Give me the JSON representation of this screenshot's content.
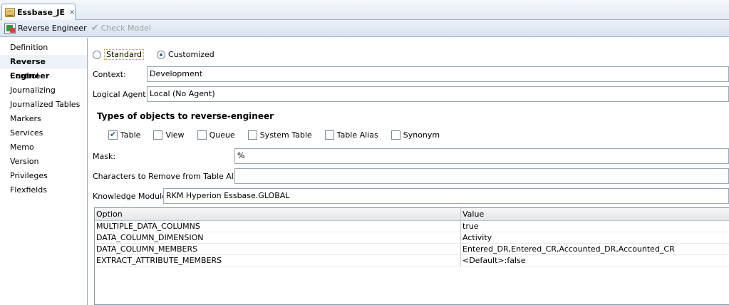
{
  "tab": {
    "title": "Essbase_JE",
    "close": "×"
  },
  "toolbar": {
    "reverse_engineer": "Reverse Engineer",
    "check_model": "Check Model"
  },
  "nav": {
    "items": [
      {
        "label": "Definition"
      },
      {
        "label": "Reverse Engineer",
        "selected": true
      },
      {
        "label": "Control"
      },
      {
        "label": "Journalizing"
      },
      {
        "label": "Journalized Tables"
      },
      {
        "label": "Markers"
      },
      {
        "label": "Services"
      },
      {
        "label": "Memo"
      },
      {
        "label": "Version"
      },
      {
        "label": "Privileges"
      },
      {
        "label": "Flexfields"
      }
    ]
  },
  "mode": {
    "standard": "Standard",
    "customized": "Customized",
    "selected": "customized"
  },
  "context": {
    "label": "Context:",
    "value": "Development"
  },
  "agent": {
    "label": "Logical Agent:",
    "value": "Local (No Agent)"
  },
  "types": {
    "title": "Types of objects to reverse-engineer",
    "options": [
      {
        "label": "Table",
        "checked": true
      },
      {
        "label": "View",
        "checked": false
      },
      {
        "label": "Queue",
        "checked": false
      },
      {
        "label": "System Table",
        "checked": false
      },
      {
        "label": "Table Alias",
        "checked": false
      },
      {
        "label": "Synonym",
        "checked": false
      }
    ]
  },
  "mask": {
    "label": "Mask:",
    "value": "%"
  },
  "chars_remove": {
    "label": "Characters to Remove from Table Alias:",
    "value": ""
  },
  "km": {
    "label": "Knowledge Module:",
    "value": "RKM Hyperion Essbase.GLOBAL"
  },
  "options_table": {
    "headers": [
      "Option",
      "Value"
    ],
    "rows": [
      [
        "MULTIPLE_DATA_COLUMNS",
        "true"
      ],
      [
        "DATA_COLUMN_DIMENSION",
        "Activity"
      ],
      [
        "DATA_COLUMN_MEMBERS",
        "Entered_DR,Entered_CR,Accounted_DR,Accounted_CR"
      ],
      [
        "EXTRACT_ATTRIBUTE_MEMBERS",
        "<Default>:false"
      ]
    ]
  }
}
